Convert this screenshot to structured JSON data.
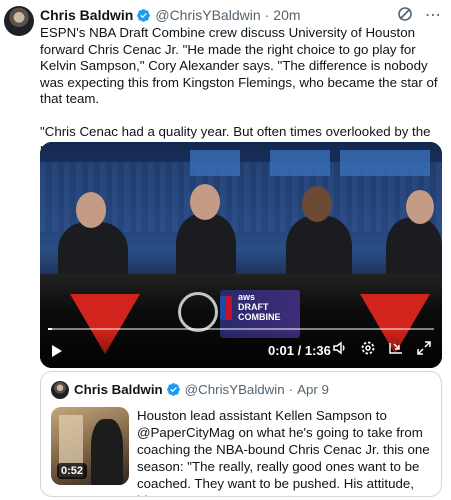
{
  "tweet": {
    "author_name": "Chris Baldwin",
    "handle": "@ChrisYBaldwin",
    "separator": "·",
    "time": "20m",
    "paragraph1": "ESPN's NBA Draft Combine crew discuss University of Houston forward Chris Cenac Jr. \"He made the right choice to go play for Kelvin Sampson,\" Cory Alexander says. \"The difference is nobody was expecting this from Kingston Flemings, who became the star of that team.",
    "paragraph2": "\"Chris Cenac had a quality year. But often times overlooked by the production of Kingston.\""
  },
  "header_icons": [
    "grok-icon",
    "more-icon"
  ],
  "video": {
    "time_readout": "0:01 / 1:36",
    "progress": 0.01,
    "overlay_text": "aws",
    "overlay_title_1": "DRAFT",
    "overlay_title_2": "COMBINE",
    "control_icons": [
      "play-icon",
      "volume-icon",
      "settings-icon",
      "pip-icon",
      "fullscreen-icon"
    ]
  },
  "quote": {
    "author_name": "Chris Baldwin",
    "handle": "@ChrisYBaldwin",
    "separator": "·",
    "date": "Apr 9",
    "video_duration": "0:52",
    "text": "Houston lead assistant Kellen Sampson to @PaperCityMag on what he's going to take from coaching the NBA-bound Chris Cenac Jr. this one season: \"The really, really good ones want to be coached. They want to be pushed. His attitude, his ..."
  },
  "colors": {
    "text": "#0f1419",
    "muted": "#536471",
    "verified": "#1d9bf0",
    "border": "#cfd9de"
  }
}
